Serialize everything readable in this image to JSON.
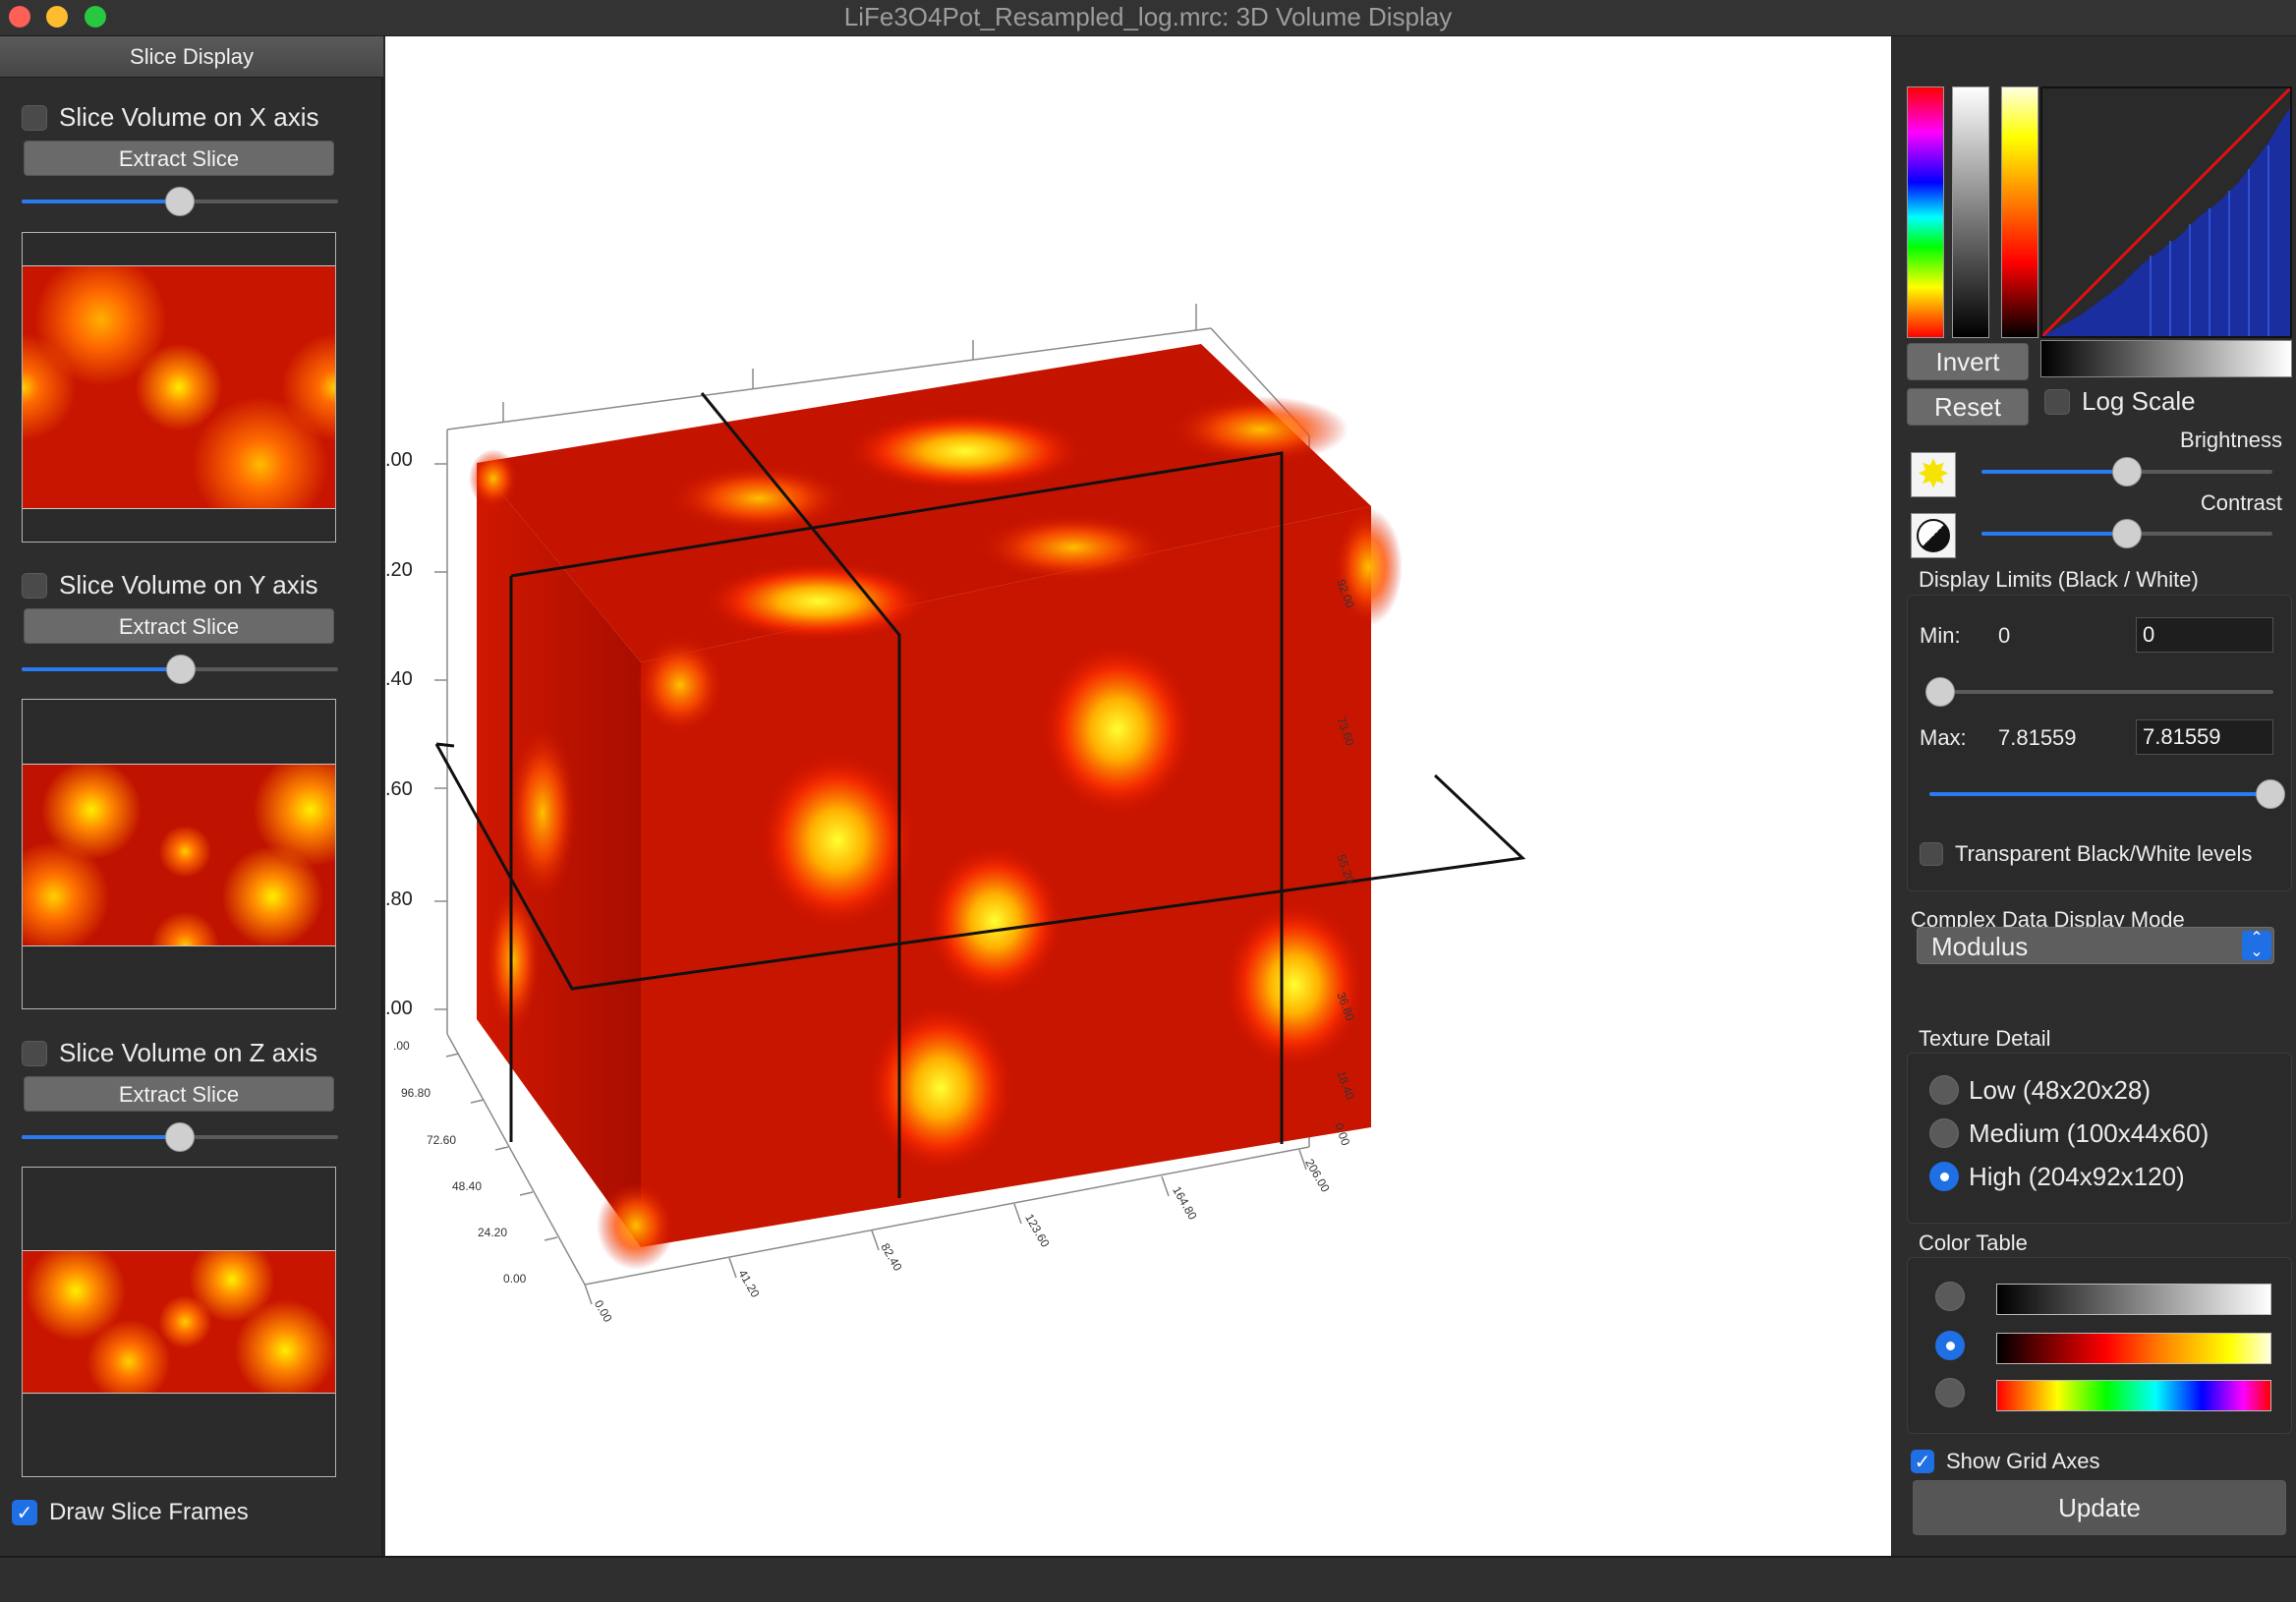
{
  "window": {
    "title": "LiFe3O4Pot_Resampled_log.mrc: 3D Volume Display"
  },
  "left_panel": {
    "header": "Slice Display",
    "x_axis": {
      "label": "Slice Volume on X axis",
      "checked": false,
      "button": "Extract Slice",
      "slider": 0.5
    },
    "y_axis": {
      "label": "Slice Volume on Y axis",
      "checked": false,
      "button": "Extract Slice",
      "slider": 0.5
    },
    "z_axis": {
      "label": "Slice Volume on Z axis",
      "checked": false,
      "button": "Extract Slice",
      "slider": 0.5
    },
    "draw_frames": {
      "label": "Draw Slice Frames",
      "checked": true
    }
  },
  "viewport": {
    "axis_left_ticks": [
      ".00",
      ".20",
      ".40",
      ".60",
      ".80",
      ".00"
    ],
    "axis_front_left_ticks": [
      ".00",
      "96.80",
      "72.60",
      "48.40",
      "24.20",
      "0.00"
    ],
    "axis_bottom_ticks": [
      "0.00",
      "41.20",
      "82.40",
      "123.60",
      "164.80",
      "206.00"
    ],
    "axis_right_ticks": [
      "92.00",
      "73.60",
      "55.20",
      "36.80",
      "18.40",
      "0.00"
    ]
  },
  "right_panel": {
    "invert": "Invert",
    "reset": "Reset",
    "log_scale": {
      "label": "Log Scale",
      "checked": false
    },
    "brightness": {
      "label": "Brightness",
      "value": 0.5
    },
    "contrast": {
      "label": "Contrast",
      "value": 0.5
    },
    "display_limits": {
      "title": "Display Limits (Black / White)",
      "min_label": "Min:",
      "min_value": "0",
      "min_input": "0",
      "min_slider": 0.0,
      "max_label": "Max:",
      "max_value": "7.81559",
      "max_input": "7.81559",
      "max_slider": 1.0,
      "transparent": {
        "label": "Transparent Black/White levels",
        "checked": false
      }
    },
    "complex_mode": {
      "title": "Complex Data Display Mode",
      "selected": "Modulus"
    },
    "texture_detail": {
      "title": "Texture Detail",
      "options": [
        {
          "label": "Low (48x20x28)",
          "selected": false
        },
        {
          "label": "Medium (100x44x60)",
          "selected": false
        },
        {
          "label": "High (204x92x120)",
          "selected": true
        }
      ]
    },
    "color_table": {
      "title": "Color Table",
      "options": [
        {
          "name": "grayscale",
          "selected": false
        },
        {
          "name": "hot",
          "selected": true
        },
        {
          "name": "rainbow",
          "selected": false
        }
      ]
    },
    "show_grid_axes": {
      "label": "Show Grid Axes",
      "checked": true
    },
    "update": "Update"
  }
}
